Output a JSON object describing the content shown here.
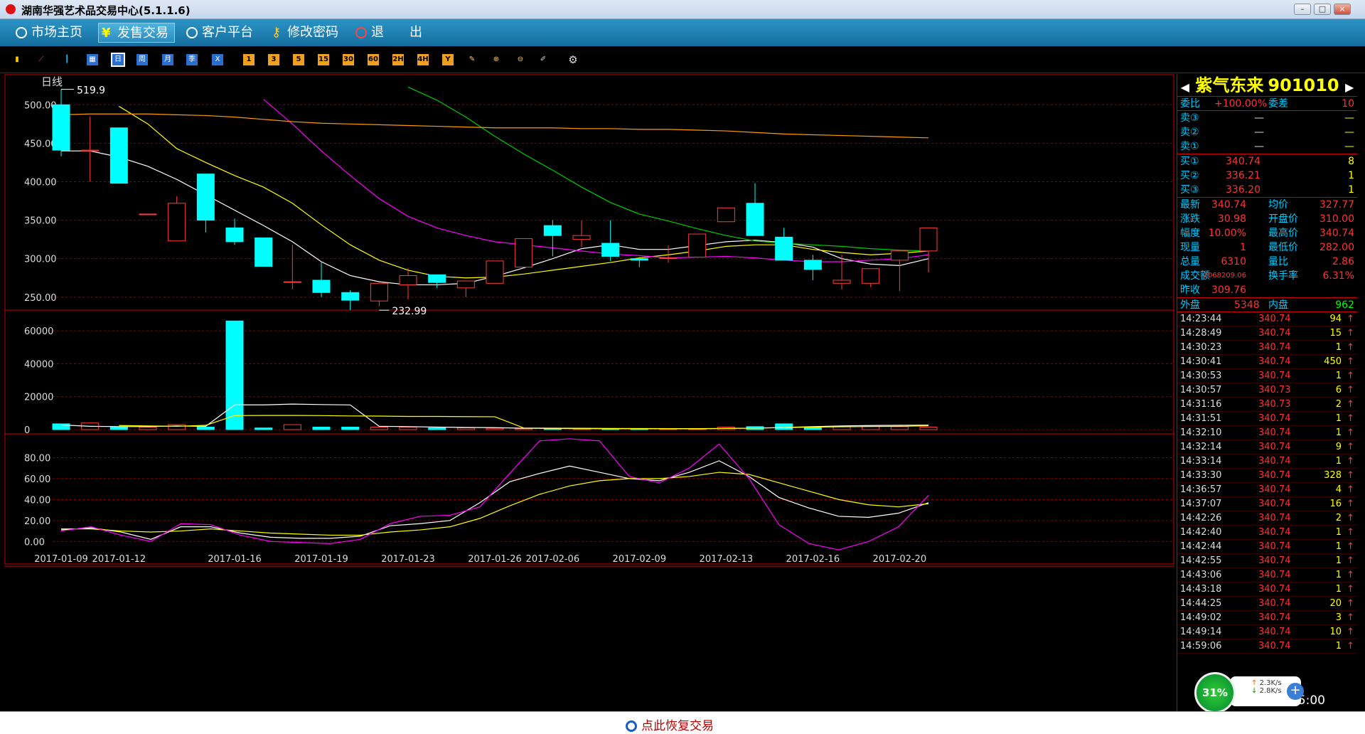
{
  "window": {
    "title": "湖南华强艺术品交易中心(5.1.1.6)"
  },
  "menu": [
    {
      "label": "市场主页",
      "icon": "home-icon"
    },
    {
      "label": "发售交易",
      "icon": "yen-icon",
      "active": true
    },
    {
      "label": "客户平台",
      "icon": "platform-icon"
    },
    {
      "label": "修改密码",
      "icon": "key-icon"
    },
    {
      "label": "退　　出",
      "icon": "power-icon"
    }
  ],
  "toolbar": {
    "period_buttons": [
      "日",
      "周",
      "月",
      "季",
      "X"
    ],
    "minute_buttons": [
      "1",
      "3",
      "5",
      "15",
      "30",
      "60",
      "2H",
      "4H",
      "Y"
    ]
  },
  "chart_label": "日线",
  "chart_data": {
    "type": "candlestick",
    "dates": [
      "2017-01-09",
      "2017-01-12",
      "2017-01-16",
      "2017-01-19",
      "2017-01-23",
      "2017-01-26",
      "2017-02-06",
      "2017-02-09",
      "2017-02-13",
      "2017-02-16",
      "2017-02-20"
    ],
    "price_ylim": [
      235,
      540
    ],
    "price_ticks": [
      "500.00",
      "450.00",
      "400.00",
      "350.00",
      "300.00",
      "250.00"
    ],
    "max_label": "519.9",
    "min_label": "232.99",
    "candles": [
      {
        "o": 500,
        "c": 441,
        "h": 520,
        "l": 433,
        "up": false
      },
      {
        "o": 440,
        "c": 441,
        "h": 485,
        "l": 400,
        "up": true
      },
      {
        "o": 470,
        "c": 398,
        "h": 470,
        "l": 398,
        "up": false
      },
      {
        "o": 358,
        "c": 358,
        "h": 358,
        "l": 358,
        "up": true
      },
      {
        "o": 323,
        "c": 372,
        "h": 381,
        "l": 323,
        "up": true
      },
      {
        "o": 410,
        "c": 350,
        "h": 410,
        "l": 334,
        "up": false
      },
      {
        "o": 340,
        "c": 322,
        "h": 352,
        "l": 318,
        "up": false
      },
      {
        "o": 327,
        "c": 290,
        "h": 327,
        "l": 290,
        "up": false
      },
      {
        "o": 270,
        "c": 270,
        "h": 318,
        "l": 260,
        "up": true
      },
      {
        "o": 272,
        "c": 256,
        "h": 295,
        "l": 250,
        "up": false
      },
      {
        "o": 256,
        "c": 246,
        "h": 259,
        "l": 233,
        "up": false
      },
      {
        "o": 245,
        "c": 268,
        "h": 268,
        "l": 238,
        "up": true
      },
      {
        "o": 266,
        "c": 278,
        "h": 288,
        "l": 247,
        "up": true
      },
      {
        "o": 279,
        "c": 269,
        "h": 279,
        "l": 262,
        "up": false
      },
      {
        "o": 262,
        "c": 271,
        "h": 271,
        "l": 250,
        "up": true
      },
      {
        "o": 268,
        "c": 297,
        "h": 297,
        "l": 268,
        "up": true
      },
      {
        "o": 289,
        "c": 326,
        "h": 326,
        "l": 289,
        "up": true
      },
      {
        "o": 343,
        "c": 330,
        "h": 350,
        "l": 303,
        "up": false
      },
      {
        "o": 325,
        "c": 330,
        "h": 350,
        "l": 315,
        "up": true
      },
      {
        "o": 320,
        "c": 303,
        "h": 350,
        "l": 297,
        "up": false
      },
      {
        "o": 300,
        "c": 298,
        "h": 302,
        "l": 289,
        "up": false
      },
      {
        "o": 301,
        "c": 301,
        "h": 317,
        "l": 295,
        "up": true
      },
      {
        "o": 302,
        "c": 332,
        "h": 332,
        "l": 302,
        "up": true
      },
      {
        "o": 348,
        "c": 366,
        "h": 366,
        "l": 348,
        "up": true
      },
      {
        "o": 372,
        "c": 330,
        "h": 398,
        "l": 330,
        "up": false
      },
      {
        "o": 328,
        "c": 298,
        "h": 340,
        "l": 298,
        "up": false
      },
      {
        "o": 298,
        "c": 286,
        "h": 305,
        "l": 272,
        "up": false
      },
      {
        "o": 268,
        "c": 272,
        "h": 305,
        "l": 260,
        "up": true
      },
      {
        "o": 268,
        "c": 287,
        "h": 287,
        "l": 263,
        "up": true
      },
      {
        "o": 298,
        "c": 310,
        "h": 310,
        "l": 258,
        "up": true
      },
      {
        "o": 310,
        "c": 340,
        "h": 340,
        "l": 282,
        "up": true
      }
    ],
    "ma_series": [
      {
        "color": "#ffffff",
        "values": [
          440,
          440,
          432,
          420,
          403,
          383,
          363,
          343,
          322,
          296,
          278,
          270,
          266,
          266,
          268,
          277,
          288,
          300,
          313,
          318,
          312,
          312,
          317,
          322,
          324,
          321,
          315,
          300,
          293,
          291,
          300
        ]
      },
      {
        "color": "#ffff00",
        "values": [
          null,
          null,
          498,
          475,
          443,
          425,
          408,
          393,
          372,
          344,
          318,
          298,
          285,
          277,
          275,
          276,
          280,
          285,
          290,
          295,
          301,
          305,
          310,
          316,
          318,
          318,
          312,
          308,
          305,
          307,
          310
        ]
      },
      {
        "color": "#ff00ff",
        "values": [
          null,
          null,
          null,
          null,
          null,
          null,
          null,
          507,
          475,
          440,
          408,
          378,
          355,
          340,
          330,
          322,
          318,
          314,
          310,
          306,
          304,
          301,
          302,
          303,
          301,
          298,
          296,
          296,
          298,
          300,
          305
        ]
      },
      {
        "color": "#00cc00",
        "values": [
          null,
          null,
          null,
          null,
          null,
          null,
          null,
          null,
          null,
          null,
          null,
          null,
          523,
          506,
          484,
          459,
          436,
          415,
          393,
          373,
          358,
          349,
          339,
          330,
          323,
          320,
          318,
          316,
          313,
          311,
          310
        ]
      },
      {
        "color": "#ff9900",
        "values": [
          487,
          488,
          488,
          488,
          487,
          486,
          484,
          481,
          478,
          476,
          475,
          474,
          473,
          472,
          471,
          470,
          470,
          470,
          469,
          469,
          468,
          468,
          467,
          466,
          464,
          462,
          461,
          460,
          459,
          458,
          457
        ]
      }
    ],
    "volume_ylim": [
      0,
      70000
    ],
    "volume_ticks": [
      "60000",
      "40000",
      "20000",
      "0"
    ],
    "volumes": [
      3500,
      4000,
      1500,
      1500,
      3000,
      1500,
      66000,
      1000,
      3000,
      1500,
      1500,
      1500,
      1500,
      1000,
      1000,
      800,
      600,
      500,
      500,
      500,
      500,
      500,
      500,
      1500,
      1800,
      3500,
      1500,
      2000,
      2000,
      1800,
      1500,
      1500,
      1700,
      6000
    ],
    "volume_ma": [
      {
        "color": "#ffffff",
        "values": [
          2800,
          2000,
          1800,
          1800,
          2200,
          2000,
          15000,
          15000,
          15500,
          15200,
          15000,
          2000,
          1800,
          1500,
          1300,
          1200,
          800,
          700,
          600,
          550,
          520,
          510,
          500,
          700,
          900,
          1300,
          1800,
          2200,
          2500,
          2600,
          2700
        ]
      },
      {
        "color": "#ffff00",
        "values": [
          null,
          null,
          2500,
          2200,
          2000,
          2600,
          8500,
          8600,
          8600,
          8500,
          8300,
          8200,
          8000,
          8000,
          7900,
          7800,
          1000,
          900,
          800,
          700,
          650,
          600,
          600,
          700,
          900,
          1200,
          1500,
          1700,
          1900,
          2000,
          2300
        ]
      }
    ],
    "kdj_ylim": [
      -10,
      100
    ],
    "kdj_ticks": [
      "80.00",
      "60.00",
      "40.00",
      "20.00",
      "0.00"
    ],
    "kdj": [
      {
        "color": "#ffffff",
        "values": [
          11,
          13,
          9,
          2,
          14,
          14,
          8,
          4,
          3,
          3,
          5,
          15,
          17,
          20,
          37,
          57,
          65,
          72,
          66,
          60,
          58,
          66,
          77,
          62,
          42,
          32,
          24,
          23,
          27,
          37
        ]
      },
      {
        "color": "#ffff00",
        "values": [
          12,
          12,
          10,
          9,
          10,
          12,
          10,
          8,
          7,
          6,
          6,
          9,
          11,
          14,
          22,
          34,
          45,
          53,
          58,
          60,
          60,
          62,
          66,
          64,
          56,
          48,
          40,
          35,
          33,
          36
        ]
      },
      {
        "color": "#ff00ff",
        "values": [
          10,
          14,
          6,
          0,
          17,
          16,
          6,
          0,
          -1,
          -2,
          2,
          17,
          24,
          25,
          33,
          65,
          96,
          98,
          96,
          62,
          56,
          70,
          93,
          60,
          16,
          -2,
          -8,
          0,
          14,
          44
        ]
      }
    ]
  },
  "quote": {
    "name": "紫气东来",
    "code": "901010",
    "weibi_label": "委比",
    "weibi": "+100.00%",
    "weicha_label": "委差",
    "weicha": "10",
    "sell": [
      {
        "label": "卖③",
        "price": "—",
        "vol": "—"
      },
      {
        "label": "卖②",
        "price": "—",
        "vol": "—"
      },
      {
        "label": "卖①",
        "price": "—",
        "vol": "—"
      }
    ],
    "buy": [
      {
        "label": "买①",
        "price": "340.74",
        "vol": "8"
      },
      {
        "label": "买②",
        "price": "336.21",
        "vol": "1"
      },
      {
        "label": "买③",
        "price": "336.20",
        "vol": "1"
      }
    ],
    "stats": [
      {
        "l1": "最新",
        "v1": "340.74",
        "l2": "均价",
        "v2": "327.77"
      },
      {
        "l1": "涨跌",
        "v1": "30.98",
        "l2": "开盘价",
        "v2": "310.00"
      },
      {
        "l1": "幅度",
        "v1": "10.00%",
        "l2": "最高价",
        "v2": "340.74"
      },
      {
        "l1": "现量",
        "v1": "1",
        "l2": "最低价",
        "v2": "282.00"
      },
      {
        "l1": "总量",
        "v1": "6310",
        "l2": "量比",
        "v2": "2.86"
      },
      {
        "l1": "成交额",
        "v1": "2068209.06",
        "l2": "换手率",
        "v2": "6.31%"
      },
      {
        "l1": "昨收",
        "v1": "309.76",
        "l2": "",
        "v2": ""
      }
    ],
    "waipan_label": "外盘",
    "waipan": "5348",
    "neipan_label": "内盘",
    "neipan": "962"
  },
  "ticks": [
    {
      "t": "14:23:44",
      "p": "340.74",
      "v": "94"
    },
    {
      "t": "14:28:49",
      "p": "340.74",
      "v": "15"
    },
    {
      "t": "14:30:23",
      "p": "340.74",
      "v": "1"
    },
    {
      "t": "14:30:41",
      "p": "340.74",
      "v": "450"
    },
    {
      "t": "14:30:53",
      "p": "340.74",
      "v": "1"
    },
    {
      "t": "14:30:57",
      "p": "340.73",
      "v": "6"
    },
    {
      "t": "14:31:16",
      "p": "340.73",
      "v": "2"
    },
    {
      "t": "14:31:51",
      "p": "340.74",
      "v": "1"
    },
    {
      "t": "14:32:10",
      "p": "340.74",
      "v": "1"
    },
    {
      "t": "14:32:14",
      "p": "340.74",
      "v": "9"
    },
    {
      "t": "14:33:14",
      "p": "340.74",
      "v": "1"
    },
    {
      "t": "14:33:30",
      "p": "340.74",
      "v": "328"
    },
    {
      "t": "14:36:57",
      "p": "340.74",
      "v": "4"
    },
    {
      "t": "14:37:07",
      "p": "340.74",
      "v": "16"
    },
    {
      "t": "14:42:26",
      "p": "340.74",
      "v": "2"
    },
    {
      "t": "14:42:40",
      "p": "340.74",
      "v": "1"
    },
    {
      "t": "14:42:44",
      "p": "340.74",
      "v": "1"
    },
    {
      "t": "14:42:55",
      "p": "340.74",
      "v": "1"
    },
    {
      "t": "14:43:06",
      "p": "340.74",
      "v": "1"
    },
    {
      "t": "14:43:18",
      "p": "340.74",
      "v": "1"
    },
    {
      "t": "14:44:25",
      "p": "340.74",
      "v": "20"
    },
    {
      "t": "14:49:02",
      "p": "340.74",
      "v": "3"
    },
    {
      "t": "14:49:14",
      "p": "340.74",
      "v": "10"
    },
    {
      "t": "14:59:06",
      "p": "340.74",
      "v": "1"
    }
  ],
  "speed": {
    "percent": "31%",
    "up": "2.3K/s",
    "down": "2.8K/s"
  },
  "clock": "15:00",
  "status": {
    "restore_label": "点此恢复交易"
  }
}
